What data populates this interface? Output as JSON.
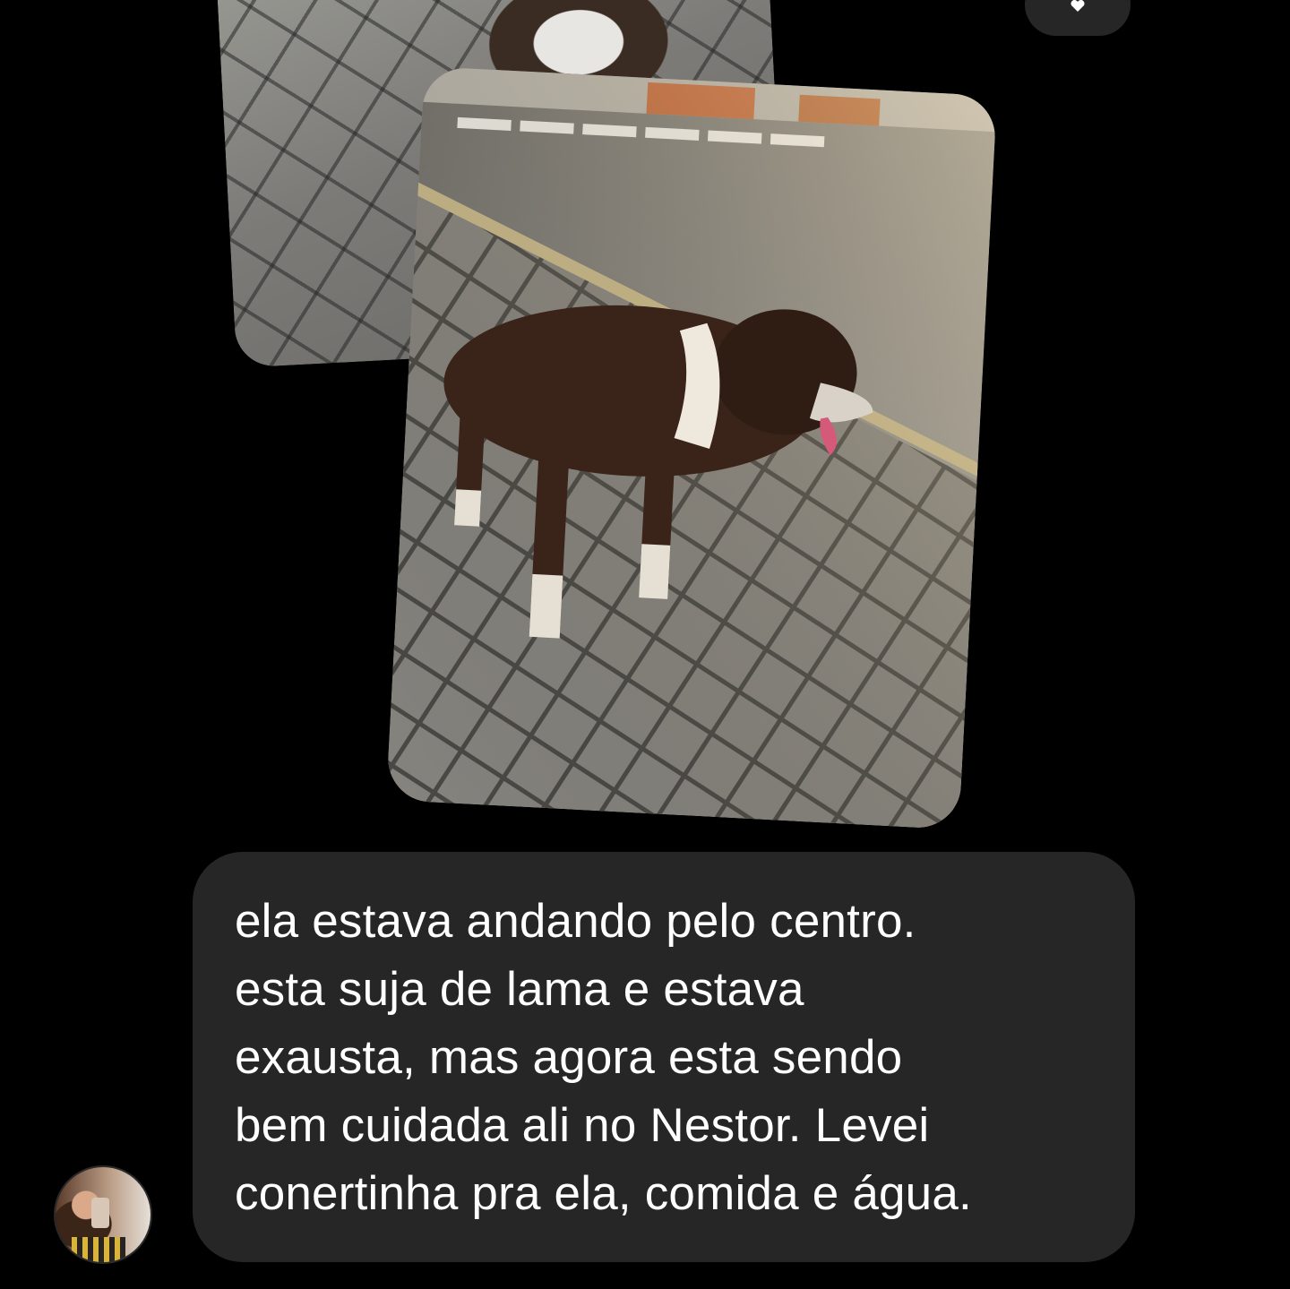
{
  "message": {
    "text": "ela estava andando pelo centro.\nesta suja de lama e estava\nexausta, mas agora esta sendo\nbem cuidada ali no Nestor. Levei\nconertinha pra ela, comida e água."
  },
  "photos": [
    {
      "subject": "dog on sidewalk"
    },
    {
      "subject": "brown and white dog standing on paved sidewalk"
    }
  ],
  "avatar": {
    "icon": "user-avatar"
  },
  "reaction": {
    "icon": "heart-icon"
  },
  "colors": {
    "background": "#000000",
    "bubble": "#262626",
    "text": "#ffffff"
  }
}
